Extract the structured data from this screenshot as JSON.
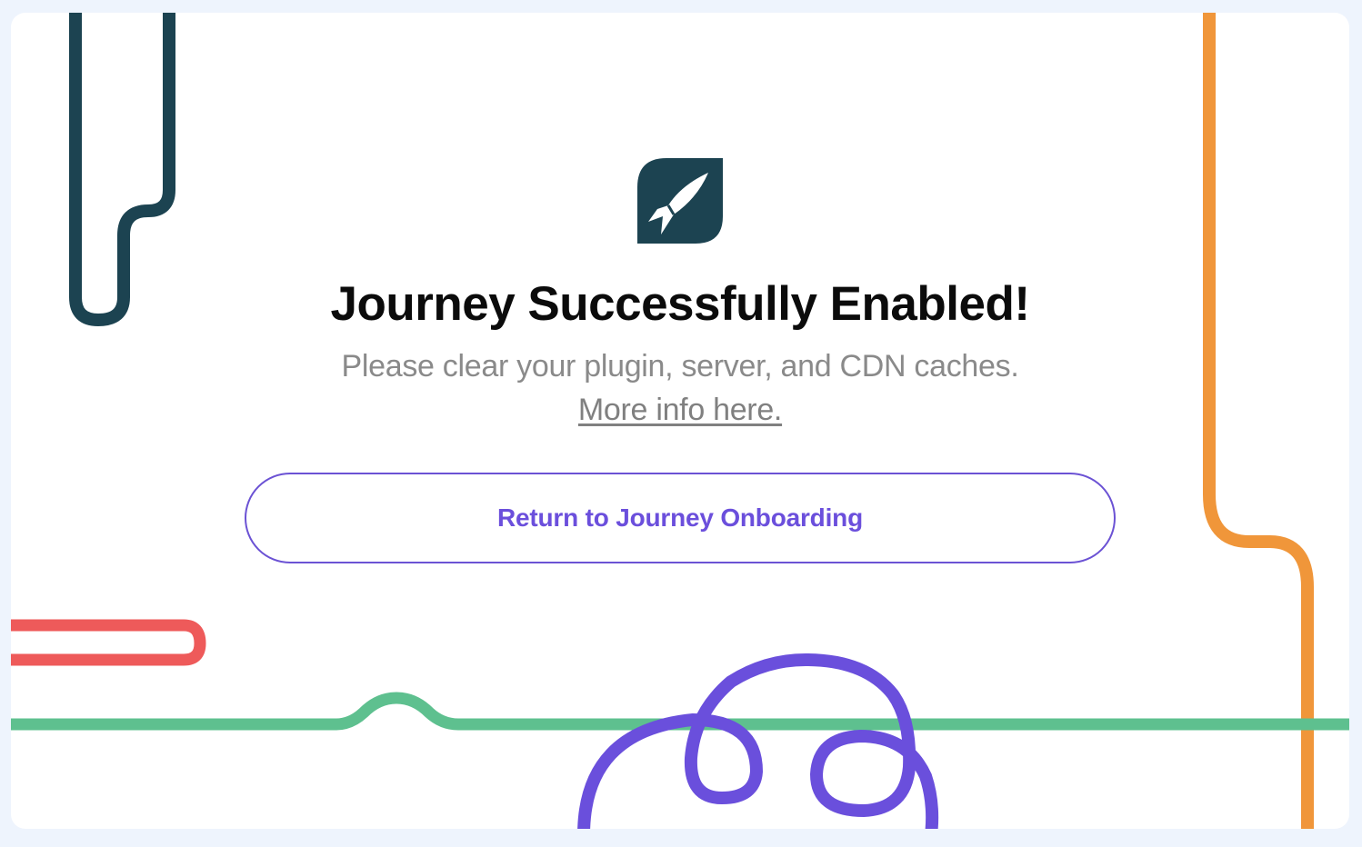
{
  "page": {
    "title": "Journey Successfully Enabled!",
    "subtitle": "Please clear your plugin, server, and CDN caches.",
    "link_text": "More info here.",
    "button_label": "Return to Journey Onboarding"
  },
  "logo": {
    "icon": "rocket-leaf-icon"
  },
  "colors": {
    "page_background": "#eef4fd",
    "card_background": "#ffffff",
    "logo_background": "#1c4351",
    "title": "#0b0b0b",
    "subtitle": "#8a8a8a",
    "accent": "#6b4fdc",
    "line_navy": "#1c4351",
    "line_orange": "#f0963a",
    "line_red": "#ee5a5a",
    "line_green": "#5ec08f",
    "line_purple": "#6a4fdc"
  }
}
